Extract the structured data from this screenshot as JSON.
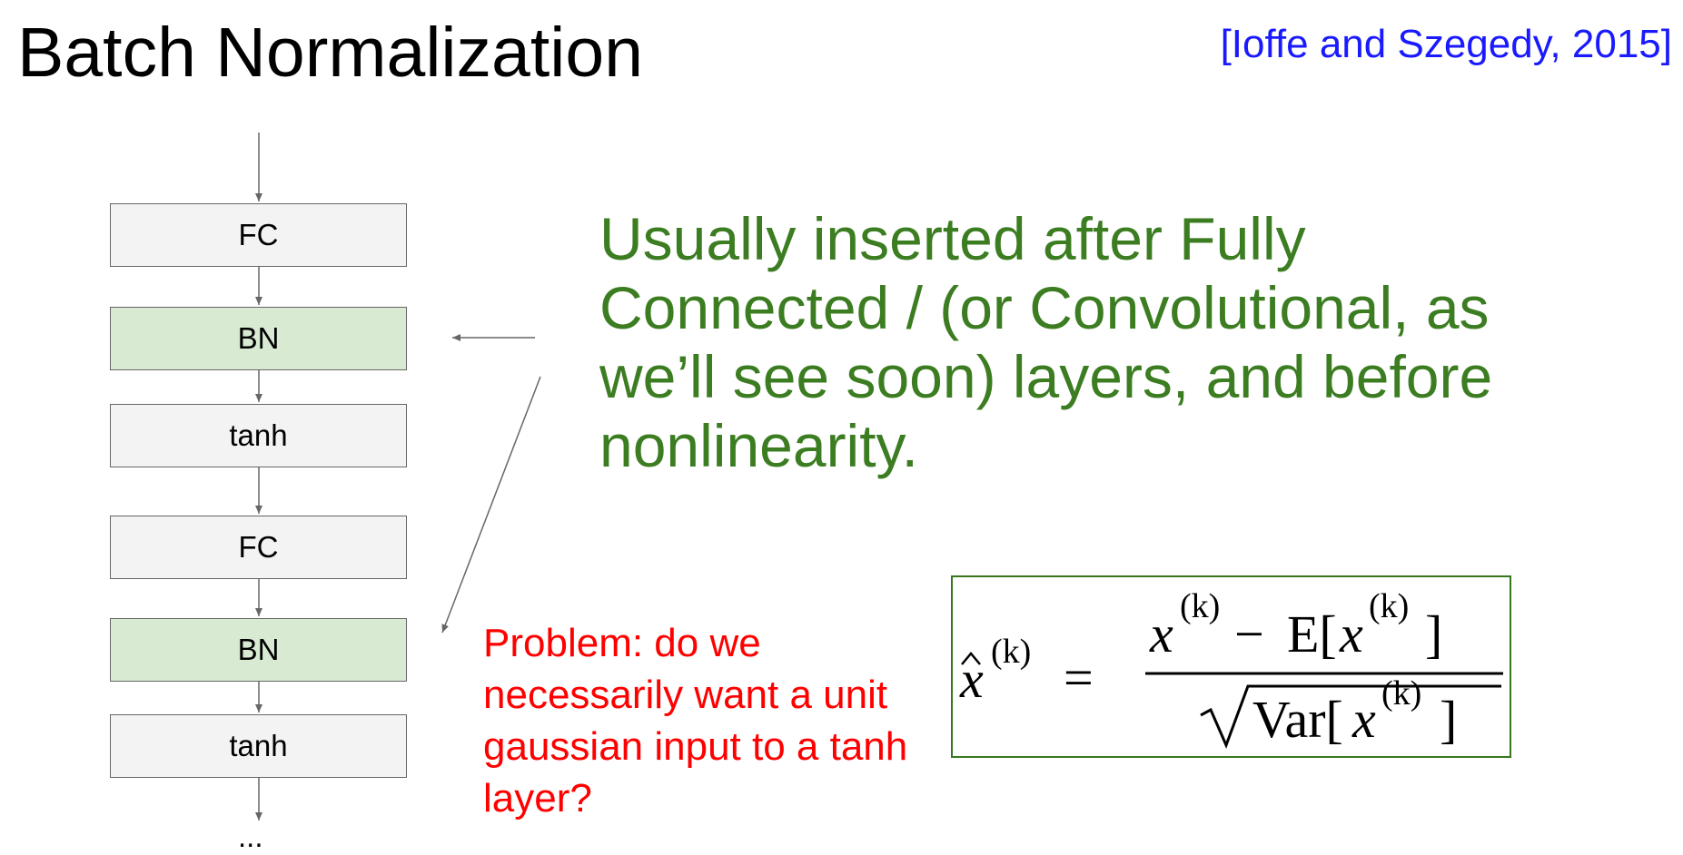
{
  "slide": {
    "title": "Batch Normalization",
    "citation": "[Ioffe and Szegedy, 2015]",
    "layers": [
      {
        "label": "FC",
        "kind": "gray"
      },
      {
        "label": "BN",
        "kind": "green"
      },
      {
        "label": "tanh",
        "kind": "gray"
      },
      {
        "label": "FC",
        "kind": "gray"
      },
      {
        "label": "BN",
        "kind": "green"
      },
      {
        "label": "tanh",
        "kind": "gray"
      }
    ],
    "ellipsis": "...",
    "note": "Usually inserted after Fully Connected / (or Convolutional, as we’ll see soon) layers, and before nonlinearity.",
    "problem": "Problem: do we necessarily want a unit gaussian input to a tanh layer?",
    "formula": {
      "lhs": "x",
      "superscript": "(k)",
      "equals": "=",
      "numerator_left": "x",
      "minus": "−",
      "expectation": "E[",
      "close_bracket": "]",
      "variance": "Var[",
      "latex": "\\widehat{x}^{(k)} = \\frac{x^{(k)} - \\mathrm{E}[x^{(k)}]}{\\sqrt{\\mathrm{Var}[x^{(k)}]}}"
    }
  },
  "colors": {
    "note": "#3c7d22",
    "problem": "#ff0000",
    "citation": "#1a1aff",
    "bn_fill": "#d9ead3",
    "layer_fill": "#f3f3f3",
    "formula_border": "#38761d"
  }
}
